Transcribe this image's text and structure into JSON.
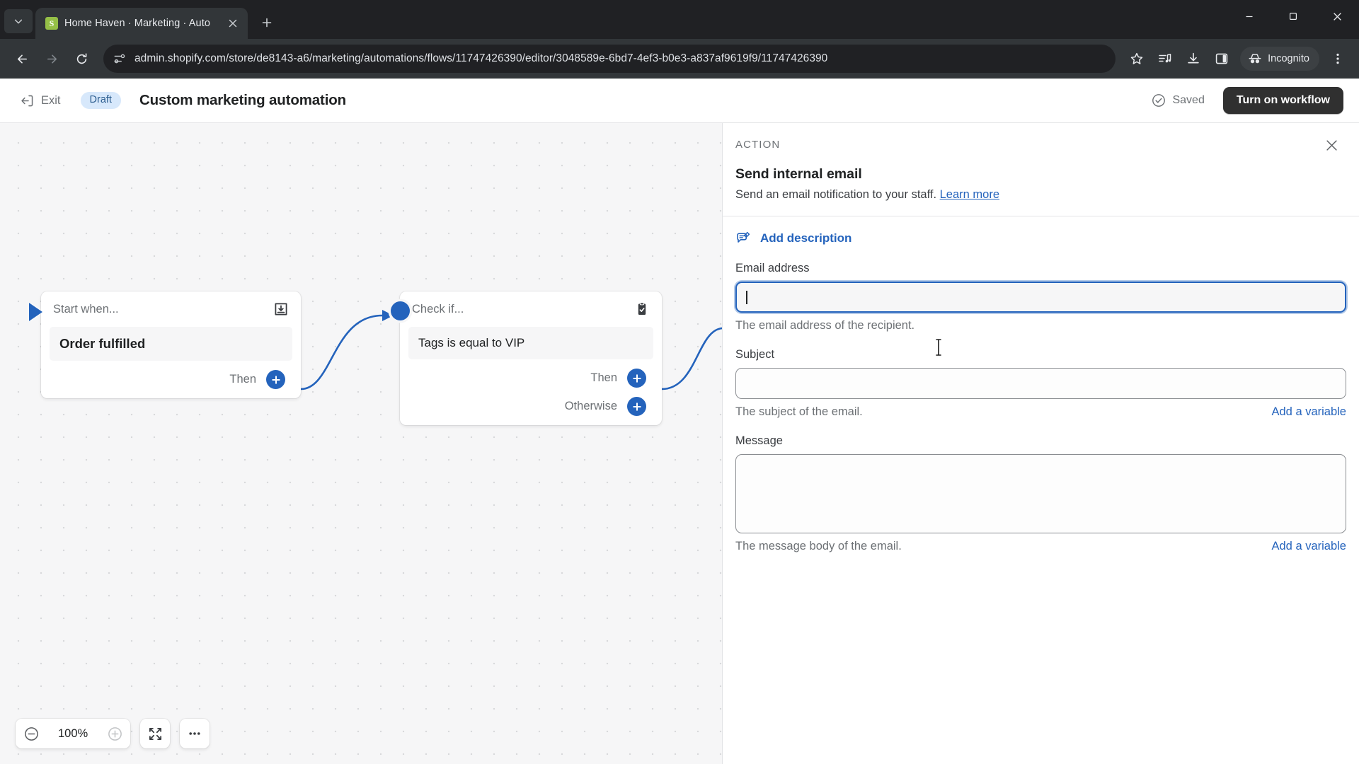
{
  "browser": {
    "tab": {
      "title": "Home Haven · Marketing · Auto",
      "favicon_label": "S"
    },
    "url": "admin.shopify.com/store/de8143-a6/marketing/automations/flows/11747426390/editor/3048589e-6bd7-4ef3-b0e3-a837af9619f9/11747426390",
    "profile_label": "Incognito",
    "icons": {
      "tab_list": "chevron-down-icon",
      "tab_close": "close-icon",
      "new_tab": "plus-icon",
      "minimize": "minimize-icon",
      "maximize": "maximize-icon",
      "window_close": "close-icon",
      "back": "back-arrow-icon",
      "forward": "forward-arrow-icon",
      "reload": "reload-icon",
      "site_settings": "site-settings-icon",
      "bookmark": "star-icon",
      "media": "media-player-icon",
      "download": "download-icon",
      "side_panel": "side-panel-icon",
      "incognito": "incognito-hat-icon",
      "menu": "kebab-menu-icon"
    }
  },
  "header": {
    "exit_label": "Exit",
    "status_badge": "Draft",
    "title": "Custom marketing automation",
    "saved_label": "Saved",
    "primary_button": "Turn on workflow"
  },
  "canvas": {
    "trigger_node": {
      "head_label": "Start when...",
      "head_icon": "order-fulfilled-icon",
      "value": "Order fulfilled",
      "branch_label": "Then"
    },
    "condition_node": {
      "head_label": "Check if...",
      "head_icon": "clipboard-check-icon",
      "value": "Tags is equal to VIP",
      "branch_then": "Then",
      "branch_otherwise": "Otherwise"
    },
    "zoom_controls": {
      "zoom_out_icon": "zoom-out-icon",
      "zoom_level": "100%",
      "zoom_in_icon": "zoom-in-icon",
      "fit_icon": "fit-to-screen-icon",
      "more_icon": "more-options-icon"
    }
  },
  "panel": {
    "eyebrow": "ACTION",
    "close_icon": "close-icon",
    "title": "Send internal email",
    "subtitle": "Send an email notification to your staff.",
    "learn_more": "Learn more",
    "add_description": "Add description",
    "add_description_icon": "add-description-icon",
    "fields": {
      "email": {
        "label": "Email address",
        "value": "",
        "help": "The email address of the recipient."
      },
      "subject": {
        "label": "Subject",
        "value": "",
        "help": "The subject of the email.",
        "add_variable": "Add a variable"
      },
      "message": {
        "label": "Message",
        "value": "",
        "help": "The message body of the email.",
        "add_variable": "Add a variable"
      }
    }
  },
  "colors": {
    "accent_blue": "#2463bc",
    "chrome_dark": "#323639",
    "chrome_darker": "#202124",
    "badge_blue_bg": "#d7e8fb",
    "primary_btn": "#303030"
  }
}
